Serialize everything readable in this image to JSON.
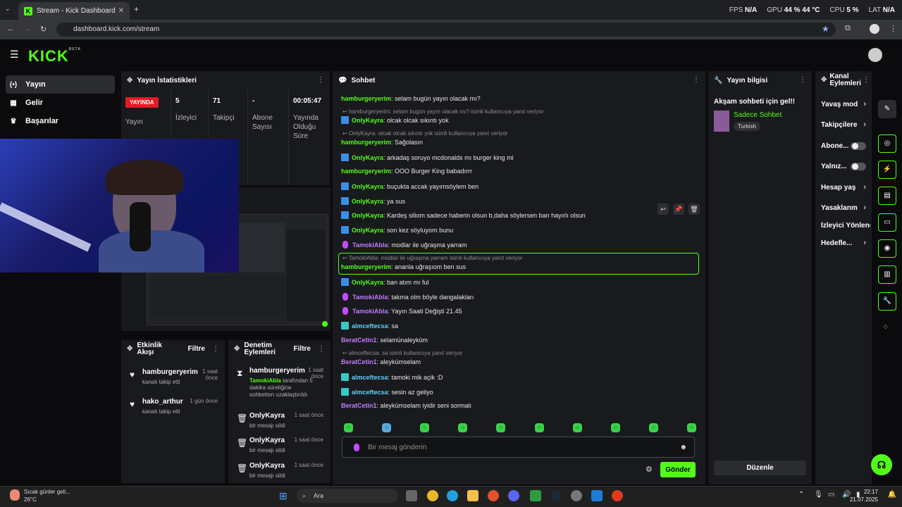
{
  "browser": {
    "tab_title": "Stream - Kick Dashboard",
    "url": "dashboard.kick.com/stream",
    "fps_label": "FPS",
    "fps_value": "N/A",
    "gpu_label": "GPU",
    "gpu_value": "44 %",
    "gpu_temp": "44 °C",
    "cpu_label": "CPU",
    "cpu_value": "5 %",
    "lat_label": "LAT",
    "lat_value": "N/A"
  },
  "logo": {
    "text": "KICK",
    "beta": "BETA"
  },
  "sidebar": {
    "items": [
      {
        "label": "Yayın",
        "icon": "(•)"
      },
      {
        "label": "Gelir",
        "icon": "▦"
      },
      {
        "label": "Başarılar",
        "icon": "♛"
      }
    ]
  },
  "stats": {
    "title": "Yayın İstatistikleri",
    "live_label": "YAYINDA",
    "stream_label": "Yayın",
    "viewers_value": "5",
    "viewers_label": "İzleyici",
    "followers_value": "71",
    "followers_label": "Takipçi",
    "subs_value": "-",
    "subs_label": "Abone Sayısı",
    "duration_value": "00:05:47",
    "duration_label": "Yayında Olduğu Süre"
  },
  "events": {
    "title": "Etkinlik Akışı",
    "filter": "Filtre",
    "items": [
      {
        "user": "hamburgeryerim",
        "time": "1 saat önce",
        "desc": "kanalı takip etti"
      },
      {
        "user": "hako_arthur",
        "time": "1 gün önce",
        "desc": "kanalı takip etti"
      }
    ]
  },
  "mod": {
    "title": "Denetim Eylemleri",
    "filter": "Filtre",
    "items": [
      {
        "user": "hamburgeryerim",
        "time": "1 saat önce",
        "actor": "TamokiAbla",
        "desc": " tarafından 5 dakika süreliğine sohbetten uzaklaştırıldı"
      },
      {
        "user": "OnlyKayra",
        "time": "1 saat önce",
        "desc": "bir mesajı sildi"
      },
      {
        "user": "OnlyKayra",
        "time": "1 saat önce",
        "desc": "bir mesajı sildi"
      },
      {
        "user": "OnlyKayra",
        "time": "1 saat önce",
        "desc": "bir mesajı sildi"
      }
    ]
  },
  "chat": {
    "title": "Sohbet",
    "messages": [
      {
        "user": "hamburgeryerim",
        "text": ": selam bugün yayın olacak mı?"
      },
      {
        "reply": "hamburgeryerim: selam bugün yayın olacak mı? isimli kullanıcıya yanıt veriyor"
      },
      {
        "user": "OnlyKayra",
        "text": ": olcak olcak sıkıntı yok"
      },
      {
        "reply": "OnlyKayra: olcak olcak sıkıntı yok isimli kullanıcıya yanıt veriyor"
      },
      {
        "user": "hamburgeryerim",
        "text": ": Sağolasın"
      },
      {
        "user": "OnlyKayra",
        "text": ": arkadaş soruyo mcdonalds mı burger king mi"
      },
      {
        "user": "hamburgeryerim",
        "text": ": OOO Burger King babadırrr"
      },
      {
        "user": "OnlyKayra",
        "text": ": buçukta accak yayımsöylem ben"
      },
      {
        "user": "OnlyKayra",
        "text": ": ya sus"
      },
      {
        "user": "OnlyKayra",
        "text": ": Kardeş siliom sadece haberin olsun b,daha söylersen ban hayırlı olsun"
      },
      {
        "user": "OnlyKayra",
        "text": ": son kez söyluyom bunu"
      },
      {
        "user": "TamokiAbla",
        "text": ": modlar ile uğraşma yarram"
      },
      {
        "reply": "TamokiAbla: modlar ile uğraşma yarram isimli kullanıcıya yanıt veriyor"
      },
      {
        "user": "hamburgeryerim",
        "text": ": ananla uğraşıom ben sus"
      },
      {
        "user": "OnlyKayra",
        "text": ": ban atım mı ful"
      },
      {
        "user": "TamokiAbla",
        "text": ": takma olm böyle dangalakları"
      },
      {
        "user": "TamokiAbla",
        "text": ": Yayın Saati Değişti 21.45"
      },
      {
        "user": "almceftecsa",
        "text": ": sa"
      },
      {
        "user": "BeratCetin1",
        "text": ": selamünaleyküm"
      },
      {
        "reply": "almceftecsa: sa isimli kullanıcıya yanıt veriyor"
      },
      {
        "user": "BeratCetin1",
        "text": ": aleykümselam"
      },
      {
        "user": "almceftecsa",
        "text": ": tamoki mik açik :D"
      },
      {
        "user": "almceftecsa",
        "text": ": sesin az geliyo"
      },
      {
        "user": "BeratCetin1",
        "text": ": aleykümselam iyidir seni sormalı"
      }
    ],
    "input_placeholder": "Bir mesaj gönderin",
    "send_label": "Gönder"
  },
  "info": {
    "title": "Yayın bilgisi",
    "stream_title": "Akşam sohbeti için gel!!",
    "category": "Sadece Sohbet",
    "language": "Turkish",
    "edit_label": "Düzenle"
  },
  "kanal": {
    "title": "Kanal Eylemleri",
    "items": [
      "Yavaş mod",
      "Takipçilere",
      "Abone...",
      "Yalnız...",
      "Hesap yaş",
      "Yasaklanm",
      "İzleyici Yönlendir",
      "Hedefle..."
    ]
  },
  "taskbar": {
    "weather_text": "Sıcak günler geli...",
    "weather_temp": "26°C",
    "search_label": "Ara",
    "time": "22:17",
    "date": "21.07.2025"
  }
}
